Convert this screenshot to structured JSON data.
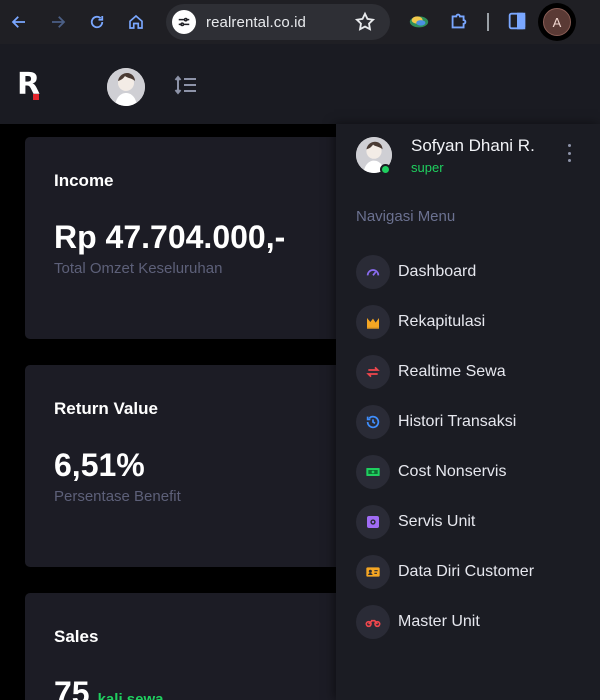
{
  "browser": {
    "url": "realrental.co.id",
    "profile_initial": "A"
  },
  "header": {
    "logo_text": "R"
  },
  "cards": [
    {
      "title": "Income",
      "value": "Rp 47.704.000,-",
      "subtitle": "Total Omzet Keseluruhan"
    },
    {
      "title": "Return Value",
      "value": "6,51%",
      "subtitle": "Persentase Benefit"
    },
    {
      "title": "Sales",
      "value": "75",
      "inline_subtitle": "kali sewa"
    }
  ],
  "dropdown": {
    "user_name": "Sofyan Dhani R.",
    "user_role": "super",
    "menu_heading": "Navigasi Menu",
    "items": [
      {
        "label": "Dashboard",
        "icon": "speedometer-icon",
        "color": "#8a6cf0"
      },
      {
        "label": "Rekapitulasi",
        "icon": "chart-area-icon",
        "color": "#f5a623"
      },
      {
        "label": "Realtime Sewa",
        "icon": "swap-arrows-icon",
        "color": "#f0474d"
      },
      {
        "label": "Histori Transaksi",
        "icon": "history-icon",
        "color": "#3f8efc"
      },
      {
        "label": "Cost Nonservis",
        "icon": "money-icon",
        "color": "#1fcf5f"
      },
      {
        "label": "Servis Unit",
        "icon": "settings-cog-icon",
        "color": "#a06cf5"
      },
      {
        "label": "Data Diri Customer",
        "icon": "id-card-icon",
        "color": "#f5a623"
      },
      {
        "label": "Master Unit",
        "icon": "motorbike-icon",
        "color": "#f0474d"
      }
    ]
  },
  "colors": {
    "accent_green": "#1fcf5f",
    "logo_dot": "#e3262d",
    "card_bg": "#1c1c25"
  }
}
